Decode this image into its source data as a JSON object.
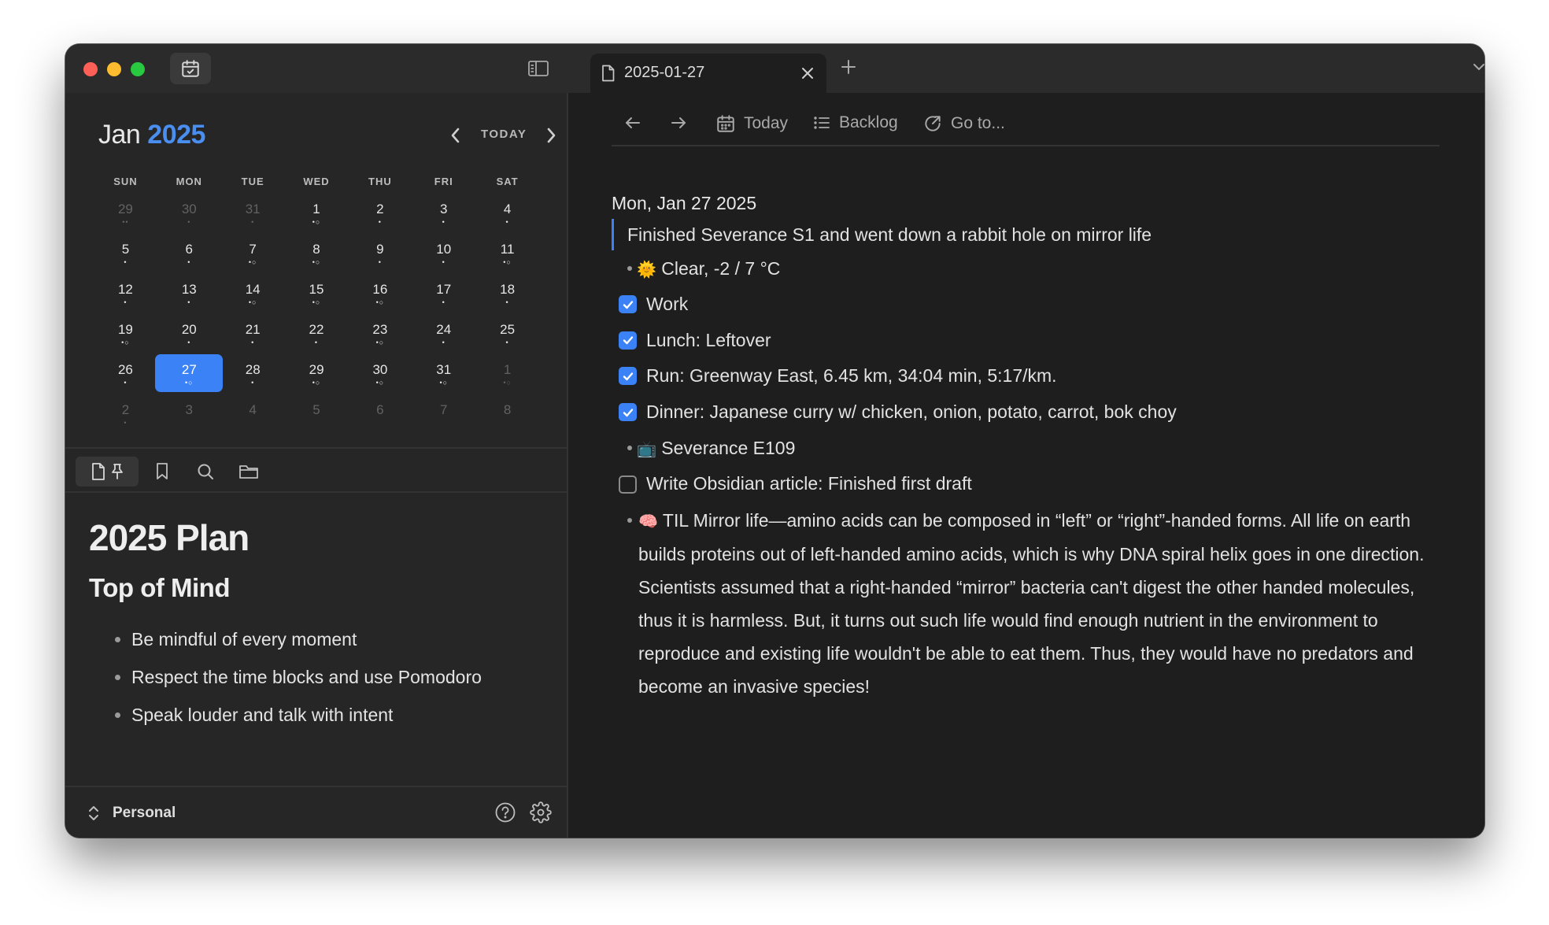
{
  "sidebar": {
    "calendar": {
      "month": "Jan",
      "year": "2025",
      "today_label": "TODAY",
      "weekdays": [
        "SUN",
        "MON",
        "TUE",
        "WED",
        "THU",
        "FRI",
        "SAT"
      ],
      "weeks": [
        [
          {
            "d": "29",
            "muted": true,
            "dots": "••"
          },
          {
            "d": "30",
            "muted": true,
            "dots": "•"
          },
          {
            "d": "31",
            "muted": true,
            "dots": "•"
          },
          {
            "d": "1",
            "dots": "•○"
          },
          {
            "d": "2",
            "dots": "•"
          },
          {
            "d": "3",
            "dots": "•"
          },
          {
            "d": "4",
            "dots": "•"
          }
        ],
        [
          {
            "d": "5",
            "dots": "•"
          },
          {
            "d": "6",
            "dots": "•"
          },
          {
            "d": "7",
            "dots": "•○"
          },
          {
            "d": "8",
            "dots": "•○"
          },
          {
            "d": "9",
            "dots": "•"
          },
          {
            "d": "10",
            "dots": "•"
          },
          {
            "d": "11",
            "dots": "•○"
          }
        ],
        [
          {
            "d": "12",
            "dots": "•"
          },
          {
            "d": "13",
            "dots": "•"
          },
          {
            "d": "14",
            "dots": "•○"
          },
          {
            "d": "15",
            "dots": "•○"
          },
          {
            "d": "16",
            "dots": "•○"
          },
          {
            "d": "17",
            "dots": "•"
          },
          {
            "d": "18",
            "dots": "•"
          }
        ],
        [
          {
            "d": "19",
            "dots": "•○"
          },
          {
            "d": "20",
            "dots": "•"
          },
          {
            "d": "21",
            "dots": "•"
          },
          {
            "d": "22",
            "dots": "•"
          },
          {
            "d": "23",
            "dots": "•○"
          },
          {
            "d": "24",
            "dots": "•"
          },
          {
            "d": "25",
            "dots": "•"
          }
        ],
        [
          {
            "d": "26",
            "dots": "•"
          },
          {
            "d": "27",
            "selected": true,
            "dots": "•○"
          },
          {
            "d": "28",
            "dots": "•"
          },
          {
            "d": "29",
            "dots": "•○"
          },
          {
            "d": "30",
            "dots": "•○"
          },
          {
            "d": "31",
            "dots": "•○"
          },
          {
            "d": "1",
            "muted": true,
            "dots": "•○"
          }
        ],
        [
          {
            "d": "2",
            "muted": true,
            "dots": "•"
          },
          {
            "d": "3",
            "muted": true,
            "dots": ""
          },
          {
            "d": "4",
            "muted": true,
            "dots": ""
          },
          {
            "d": "5",
            "muted": true,
            "dots": ""
          },
          {
            "d": "6",
            "muted": true,
            "dots": ""
          },
          {
            "d": "7",
            "muted": true,
            "dots": ""
          },
          {
            "d": "8",
            "muted": true,
            "dots": ""
          }
        ]
      ]
    },
    "note": {
      "title": "2025 Plan",
      "subtitle": "Top of Mind",
      "items": [
        "Be mindful of every moment",
        "Respect the time blocks and use Pomodoro",
        "Speak louder and talk with intent"
      ]
    },
    "footer": {
      "vault_name": "Personal"
    }
  },
  "tab": {
    "title": "2025-01-27"
  },
  "toolbar": {
    "today": "Today",
    "backlog": "Backlog",
    "goto": "Go to..."
  },
  "doc": {
    "date": "Mon, Jan 27 2025",
    "quote": "Finished Severance S1 and went down a rabbit hole on mirror life",
    "weather_emoji": "🌞",
    "weather": "Clear, -2 / 7 °C",
    "checks": [
      {
        "label": "Work",
        "checked": true
      },
      {
        "label": "Lunch: Leftover",
        "checked": true
      },
      {
        "label": "Run: Greenway East, 6.45 km, 34:04 min, 5:17/km.",
        "checked": true
      },
      {
        "label": "Dinner: Japanese curry w/ chicken, onion, potato, carrot, bok choy",
        "checked": true
      }
    ],
    "tv_emoji": "📺",
    "tv": "Severance E109",
    "task": {
      "label": "Write Obsidian article: Finished first draft",
      "checked": false
    },
    "til_emoji": "🧠",
    "til": "TIL Mirror life—amino acids can be composed in “left” or “right”-handed forms. All life on earth builds proteins out of left-handed amino acids, which is why DNA spiral helix goes in one direction. Scientists assumed that a right-handed “mirror” bacteria can't digest the other handed molecules, thus it is harmless. But, it turns out such life would find enough nutrient in the environment to reproduce and existing life wouldn't be able to eat them. Thus, they would have no predators and become an invasive species!"
  },
  "colors": {
    "accent": "#3b82f6",
    "year": "#4a8ef0",
    "background": "#1e1e1e",
    "sidebar": "#262626"
  }
}
